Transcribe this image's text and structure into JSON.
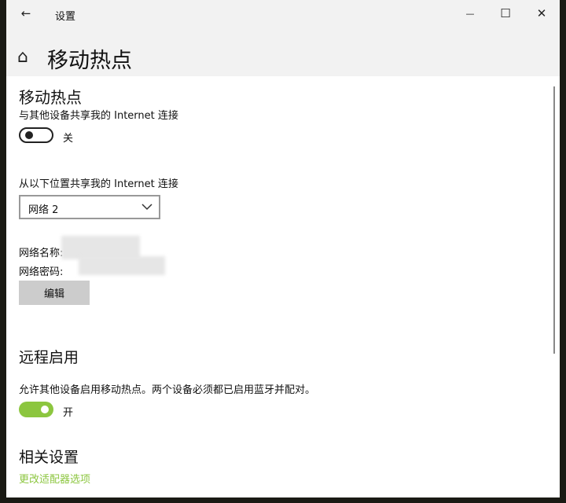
{
  "titlebar": {
    "title": "设置",
    "back": "←",
    "minimize": "—",
    "maximize": "☐",
    "close": "✕"
  },
  "page": {
    "title": "移动热点",
    "home_icon": "⌂"
  },
  "hotspot": {
    "heading": "移动热点",
    "desc": "与其他设备共享我的 Internet 连接",
    "toggle_label": "关",
    "toggle_on": false
  },
  "share_from": {
    "label": "从以下位置共享我的 Internet 连接",
    "selected": "网络 2"
  },
  "network": {
    "name_label": "网络名称:",
    "password_label": "网络密码:",
    "edit_button": "编辑"
  },
  "remote": {
    "heading": "远程启用",
    "desc": "允许其他设备启用移动热点。两个设备必须都已启用蓝牙并配对。",
    "toggle_label": "开",
    "toggle_on": true
  },
  "related": {
    "heading": "相关设置",
    "link": "更改适配器选项"
  },
  "colors": {
    "accent": "#8cc63f",
    "link": "#8cc63f"
  }
}
